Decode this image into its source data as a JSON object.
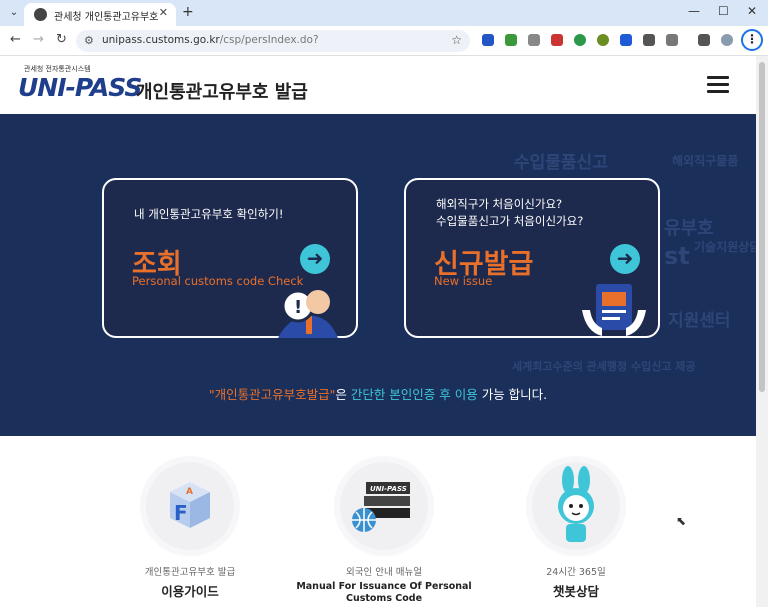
{
  "browser": {
    "tab_title": "관세청 개인통관고유부호",
    "url_host": "unipass.customs.go.kr",
    "url_path": "/csp/persIndex.do?"
  },
  "header": {
    "logo_small": "관세청 전자통관시스템",
    "logo_main": "UNI-PASS",
    "title": "개인통관고유부호 발급"
  },
  "hero": {
    "background_words": [
      "수입물품신고",
      "해외직구물품",
      "유부호",
      "st",
      "기술지원상담",
      "지원센터",
      "세계최고수준의 관세행정 수입신고 제공"
    ],
    "lookup": {
      "subtitle": "내 개인통관고유부호 확인하기!",
      "title": "조회",
      "english": "Personal customs code Check"
    },
    "issue": {
      "subtitle_line1": "해외직구가 처음이신가요?",
      "subtitle_line2": "수입물품신고가 처음이신가요?",
      "title": "신규발급",
      "english": "New issue"
    },
    "note_part1": "\"개인통관고유부호발급\"",
    "note_part2": "은 ",
    "note_part3": "간단한 본인인증 후 이용",
    "note_part4": " 가능 합니다."
  },
  "features": [
    {
      "sub": "개인통관고유부호 발급",
      "main": "이용가이드",
      "icon": "guide-box-icon"
    },
    {
      "sub": "외국인 안내 매뉴얼",
      "main": "Manual For Issuance Of Personal Customs Code",
      "icon": "manual-books-icon",
      "logo_text": "UNI-PASS"
    },
    {
      "sub": "24시간 365일",
      "main": "챗봇상담",
      "icon": "chatbot-rabbit-icon"
    }
  ],
  "colors": {
    "hero_bg": "#1b2f5b",
    "accent_orange": "#e8702a",
    "accent_teal": "#3ec6d8"
  }
}
